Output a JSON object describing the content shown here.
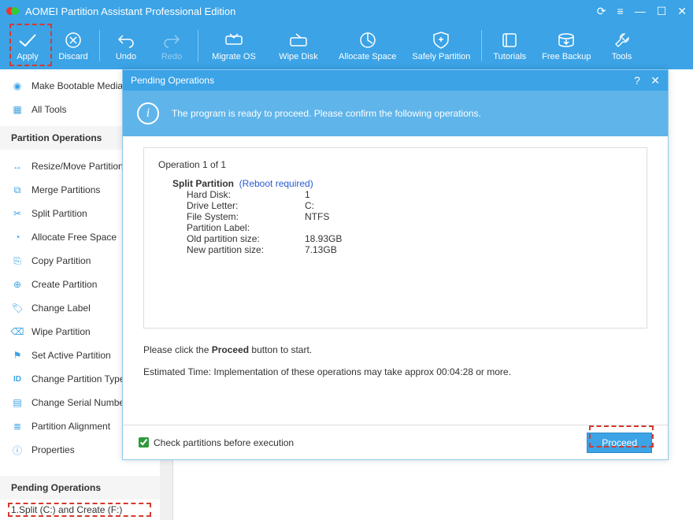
{
  "titlebar": {
    "title": "AOMEI Partition Assistant Professional Edition"
  },
  "toolbar": {
    "apply": "Apply",
    "discard": "Discard",
    "undo": "Undo",
    "redo": "Redo",
    "migrate": "Migrate OS",
    "wipe": "Wipe Disk",
    "allocate": "Allocate Space",
    "safely": "Safely Partition",
    "tutorials": "Tutorials",
    "backup": "Free Backup",
    "tools": "Tools"
  },
  "sidebar": {
    "wizards": {
      "bootable": "Make Bootable Media",
      "alltools": "All Tools"
    },
    "partops_head": "Partition Operations",
    "partops": {
      "resize": "Resize/Move Partition",
      "merge": "Merge Partitions",
      "split": "Split Partition",
      "allocfree": "Allocate Free Space",
      "copy": "Copy Partition",
      "create": "Create Partition",
      "label": "Change Label",
      "wipe": "Wipe Partition",
      "active": "Set Active Partition",
      "parttype": "Change Partition Type",
      "serial": "Change Serial Number",
      "align": "Partition Alignment",
      "props": "Properties"
    },
    "pending_head": "Pending Operations",
    "pending_item": "1.Split (C:) and Create (F:)"
  },
  "modal": {
    "title": "Pending Operations",
    "banner": "The program is ready to proceed. Please confirm the following operations.",
    "op_count": "Operation 1 of 1",
    "op_name": "Split Partition",
    "op_reboot": "(Reboot required)",
    "rows": {
      "hd_k": "Hard Disk:",
      "hd_v": "1",
      "dl_k": "Drive Letter:",
      "dl_v": "C:",
      "fs_k": "File System:",
      "fs_v": "NTFS",
      "pl_k": "Partition Label:",
      "pl_v": "",
      "old_k": "Old partition size:",
      "old_v": "18.93GB",
      "new_k": "New partition size:",
      "new_v": "7.13GB"
    },
    "hint_pre": "Please click the ",
    "hint_bold": "Proceed",
    "hint_post": " button to start.",
    "est_label": "Estimated Time:",
    "est_text": " Implementation of these operations may take approx ",
    "est_time": "00:04:28",
    "est_tail": " or more.",
    "check_label": "Check partitions before execution",
    "proceed": "Proceed"
  }
}
